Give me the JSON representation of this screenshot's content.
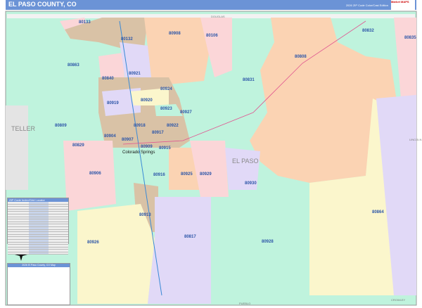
{
  "header": {
    "title": "EL PASO COUNTY, CO",
    "edition": "2026 ZIP Code Color/Cast Edition",
    "logo": "Market MAPS"
  },
  "counties": {
    "north": "DOUGLAS",
    "west": "TELLER",
    "center": "EL PASO",
    "south": "PUEBLO",
    "east": "LINCOLN",
    "southeast": "CROWLEY"
  },
  "city": "Colorado Springs",
  "zips": [
    "80133",
    "80132",
    "80908",
    "80106",
    "80832",
    "80863",
    "80840",
    "80921",
    "80808",
    "80831",
    "80835",
    "80919",
    "80920",
    "80924",
    "80923",
    "80927",
    "80918",
    "80922",
    "80809",
    "80904",
    "80917",
    "80829",
    "80907",
    "80909",
    "80915",
    "80906",
    "80916",
    "80925",
    "80929",
    "80930",
    "80913",
    "80864",
    "80817",
    "80926",
    "80928"
  ],
  "index": {
    "title": "ZIP Code Index/Grid Locator"
  },
  "legend": {
    "title": "2026 El Paso County, CO Map"
  },
  "colors": {
    "teal": "#bff3dd",
    "peach": "#fbd3b3",
    "pink": "#fbd6d8",
    "lavender": "#e1d9f7",
    "yellow": "#fbf6cc",
    "tan": "#d9c2a6",
    "header": "#6b93d6",
    "label": "#2d56a8"
  }
}
